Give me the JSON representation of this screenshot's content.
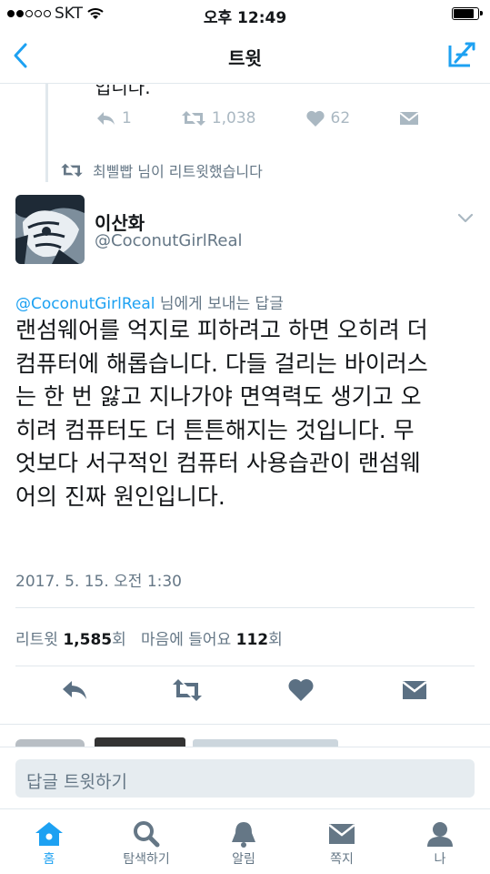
{
  "status_bar": {
    "carrier": "SKT",
    "time": "오후 12:49",
    "signal_bars": 2,
    "battery_level": 0.85
  },
  "nav": {
    "title": "트윗",
    "back_icon": "chevron-left-icon",
    "compose_icon": "compose-icon"
  },
  "previous_tweet": {
    "partial_text": "입니다.",
    "replies": "1",
    "retweets": "1,038",
    "likes": "62"
  },
  "retweet_context": {
    "text": "최삘빱 님이 리트윗했습니다"
  },
  "tweet": {
    "display_name": "이산화",
    "username": "@CoconutGirlReal",
    "reply_handle": "@CoconutGirlReal",
    "reply_suffix": " 님에게 보내는 답글",
    "lines": [
      "랜섬웨어를 억지로 피하려고 하면 오히려 더",
      "컴퓨터에 해롭습니다. 다들 걸리는 바이러스",
      "는 한 번 앓고 지나가야 면역력도 생기고 오",
      "히려 컴퓨터도 더 튼튼해지는 것입니다. 무",
      "엇보다 서구적인 컴퓨터 사용습관이 랜섬웨",
      "어의 진짜 원인입니다."
    ],
    "timestamp": "2017. 5. 15. 오전 1:30",
    "retweet_label": "리트윗",
    "retweet_count": "1,585",
    "count_suffix": "회",
    "like_label": "마음에 들어요",
    "like_count": "112"
  },
  "reply_input": {
    "placeholder": "답글 트윗하기"
  },
  "tabs": [
    {
      "label": "홈",
      "icon": "home-icon",
      "active": true
    },
    {
      "label": "탐색하기",
      "icon": "search-icon",
      "active": false
    },
    {
      "label": "알림",
      "icon": "bell-icon",
      "active": false
    },
    {
      "label": "쪽지",
      "icon": "envelope-icon",
      "active": false
    },
    {
      "label": "나",
      "icon": "person-icon",
      "active": false
    }
  ],
  "colors": {
    "accent": "#1da1f2",
    "muted": "#657786",
    "icon_gray": "#aab8c2",
    "action_gray": "#5b7083",
    "text": "#14171a"
  }
}
